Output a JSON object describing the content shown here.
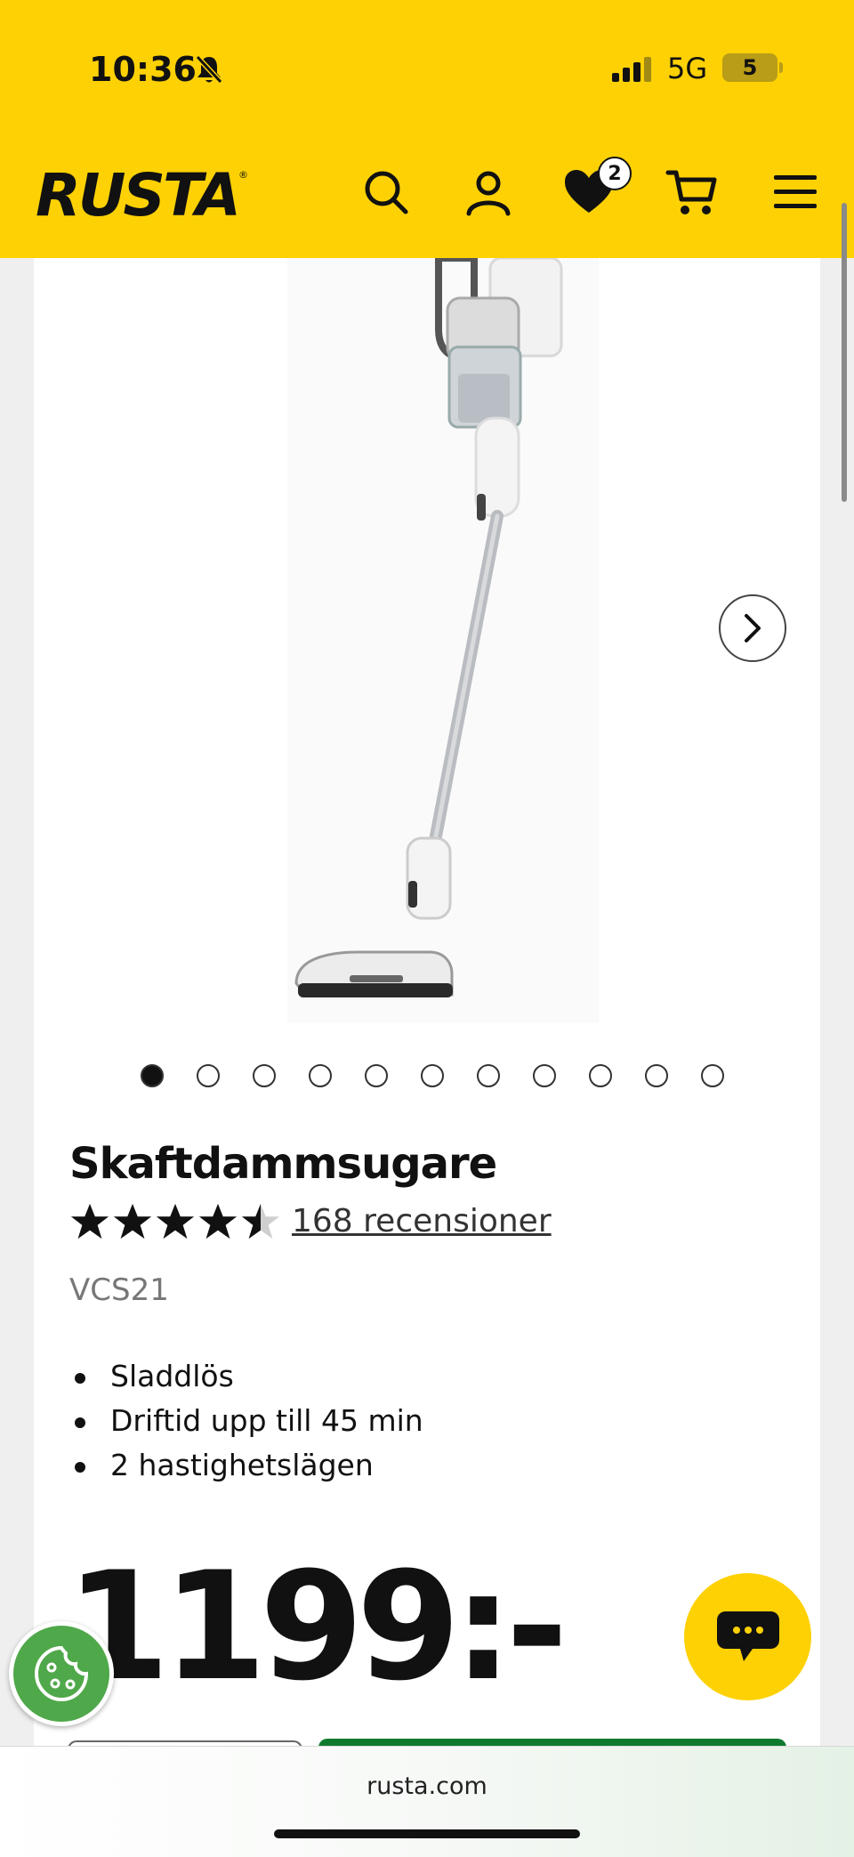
{
  "status_bar": {
    "time": "10:36",
    "network": "5G",
    "battery": "5"
  },
  "header": {
    "brand": "RUSTA",
    "favorites_count": "2",
    "accent_color": "#fdd104"
  },
  "product": {
    "title": "Skaftdammsugare",
    "rating": 4.5,
    "rating_max": 5,
    "reviews_label": "168 recensioner",
    "model": "VCS21",
    "features": [
      "Sladdlös",
      "Driftid upp till 45 min",
      "2 hastighetslägen"
    ],
    "price": "1199:-",
    "gallery_total": 11,
    "gallery_active": 1
  },
  "browser": {
    "url": "rusta.com"
  }
}
